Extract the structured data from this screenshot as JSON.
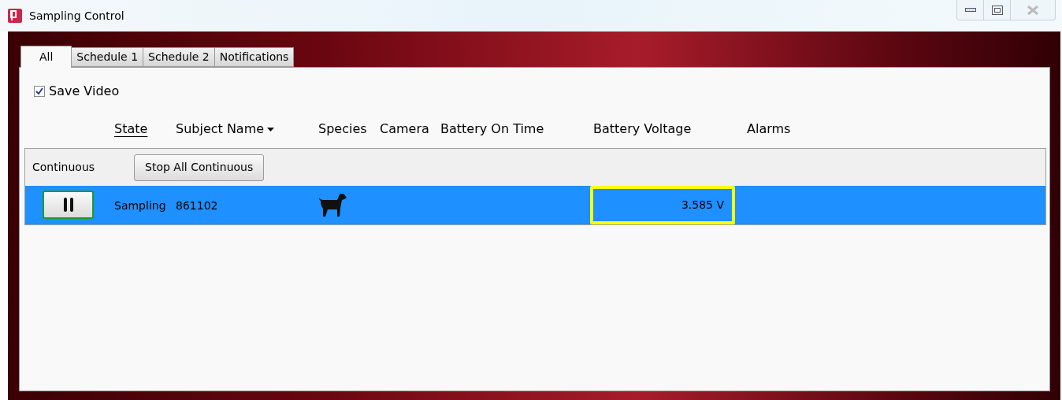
{
  "window": {
    "title": "Sampling Control"
  },
  "tabs": [
    {
      "label": "All",
      "selected": true
    },
    {
      "label": "Schedule 1",
      "selected": false
    },
    {
      "label": "Schedule 2",
      "selected": false
    },
    {
      "label": "Notifications",
      "selected": false
    }
  ],
  "save_video": {
    "label": "Save Video",
    "checked": true
  },
  "columns": [
    {
      "label": "State",
      "underlined": true,
      "sorted": false
    },
    {
      "label": "Subject Name",
      "underlined": false,
      "sorted": true
    },
    {
      "label": "Species",
      "underlined": false,
      "sorted": false
    },
    {
      "label": "Camera",
      "underlined": false,
      "sorted": false
    },
    {
      "label": "Battery On Time",
      "underlined": false,
      "sorted": false
    },
    {
      "label": "Battery Voltage",
      "underlined": false,
      "sorted": false
    },
    {
      "label": "Alarms",
      "underlined": false,
      "sorted": false
    }
  ],
  "group": {
    "label": "Continuous",
    "button": "Stop All Continuous"
  },
  "rows": [
    {
      "selected": true,
      "state": "Sampling",
      "subject": "861102",
      "battery_voltage": "3.585 V",
      "voltage_highlighted": true
    }
  ]
}
